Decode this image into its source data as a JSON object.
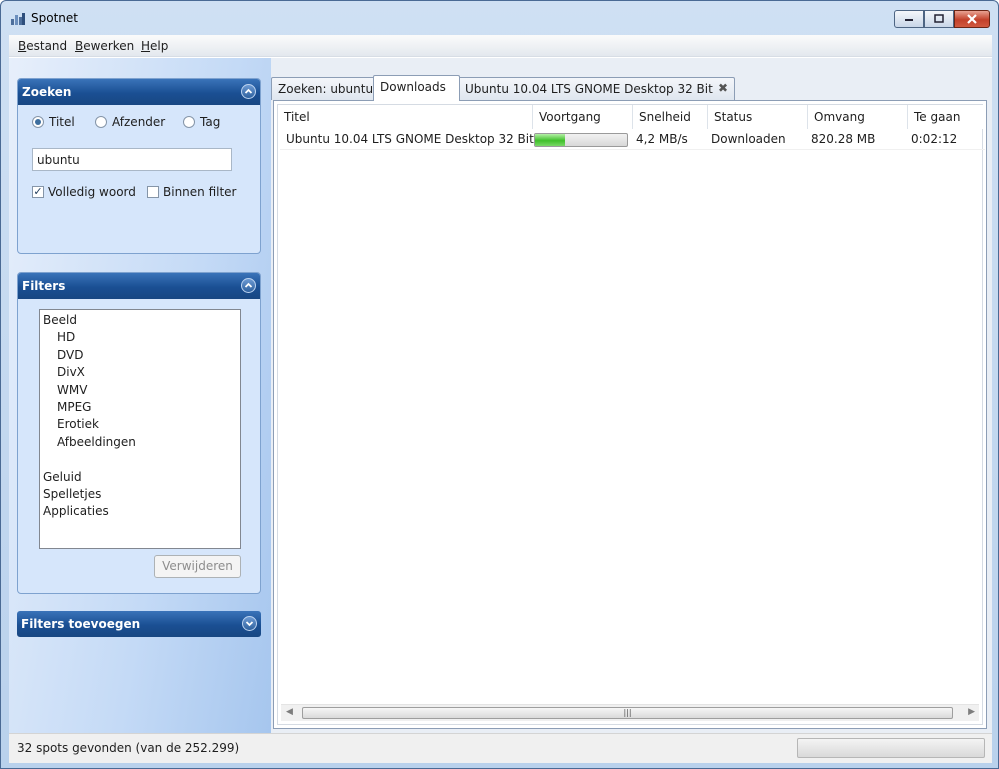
{
  "window": {
    "title": "Spotnet"
  },
  "menu": {
    "items": [
      "Bestand",
      "Bewerken",
      "Help"
    ]
  },
  "search_panel": {
    "title": "Zoeken",
    "radios": [
      {
        "label": "Titel",
        "selected": true
      },
      {
        "label": "Afzender",
        "selected": false
      },
      {
        "label": "Tag",
        "selected": false
      }
    ],
    "query": "ubuntu",
    "checkboxes": [
      {
        "label": "Volledig woord",
        "checked": true
      },
      {
        "label": "Binnen filter",
        "checked": false
      }
    ]
  },
  "filters_panel": {
    "title": "Filters",
    "items": [
      {
        "label": "Beeld",
        "level": 0
      },
      {
        "label": "HD",
        "level": 1
      },
      {
        "label": "DVD",
        "level": 1
      },
      {
        "label": "DivX",
        "level": 1
      },
      {
        "label": "WMV",
        "level": 1
      },
      {
        "label": "MPEG",
        "level": 1
      },
      {
        "label": "Erotiek",
        "level": 1
      },
      {
        "label": "Afbeeldingen",
        "level": 1
      },
      {
        "label": "",
        "level": 0
      },
      {
        "label": "Geluid",
        "level": 0
      },
      {
        "label": "Spelletjes",
        "level": 0
      },
      {
        "label": "Applicaties",
        "level": 0
      }
    ],
    "remove_button": "Verwijderen"
  },
  "add_filters_panel": {
    "title": "Filters toevoegen"
  },
  "tabs": [
    {
      "label": "Zoeken: ubuntu",
      "active": false,
      "closable": false
    },
    {
      "label": "Downloads",
      "active": true,
      "closable": false
    },
    {
      "label": "Ubuntu 10.04 LTS GNOME Desktop 32 Bit",
      "active": false,
      "closable": true
    }
  ],
  "downloads": {
    "columns": [
      "Titel",
      "Voortgang",
      "Snelheid",
      "Status",
      "Omvang",
      "Te gaan"
    ],
    "rows": [
      {
        "titel": "Ubuntu 10.04 LTS GNOME Desktop 32 Bit",
        "voortgang": 0.33,
        "snelheid": "4,2 MB/s",
        "status": "Downloaden",
        "omvang": "820.28 MB",
        "te_gaan": "0:02:12"
      }
    ]
  },
  "statusbar": {
    "text": "32 spots gevonden (van de 252.299)"
  },
  "colors": {
    "panel_header": "#1a4f93",
    "progress_fill": "#3fbf2a",
    "close_button": "#c3412a"
  }
}
